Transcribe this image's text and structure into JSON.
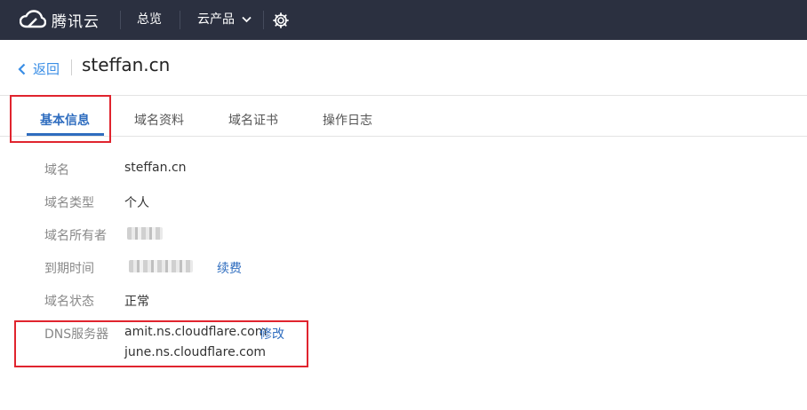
{
  "topbar": {
    "brand": "腾讯云",
    "nav": [
      {
        "label": "总览"
      },
      {
        "label": "云产品"
      }
    ]
  },
  "header": {
    "back_label": "返回",
    "title": "steffan.cn"
  },
  "tabs": [
    {
      "label": "基本信息",
      "active": true
    },
    {
      "label": "域名资料",
      "active": false
    },
    {
      "label": "域名证书",
      "active": false
    },
    {
      "label": "操作日志",
      "active": false
    }
  ],
  "info": {
    "domain": {
      "label": "域名",
      "value": "steffan.cn"
    },
    "type": {
      "label": "域名类型",
      "value": "个人"
    },
    "owner": {
      "label": "域名所有者"
    },
    "expiry": {
      "label": "到期时间",
      "action": "续费"
    },
    "status": {
      "label": "域名状态",
      "value": "正常"
    },
    "dns": {
      "label": "DNS服务器",
      "servers": [
        "amit.ns.cloudflare.com",
        "june.ns.cloudflare.com"
      ],
      "action": "修改"
    }
  },
  "colors": {
    "topbar_bg": "#2b3040",
    "accent": "#2f6dbf",
    "highlight": "#e0242e"
  }
}
